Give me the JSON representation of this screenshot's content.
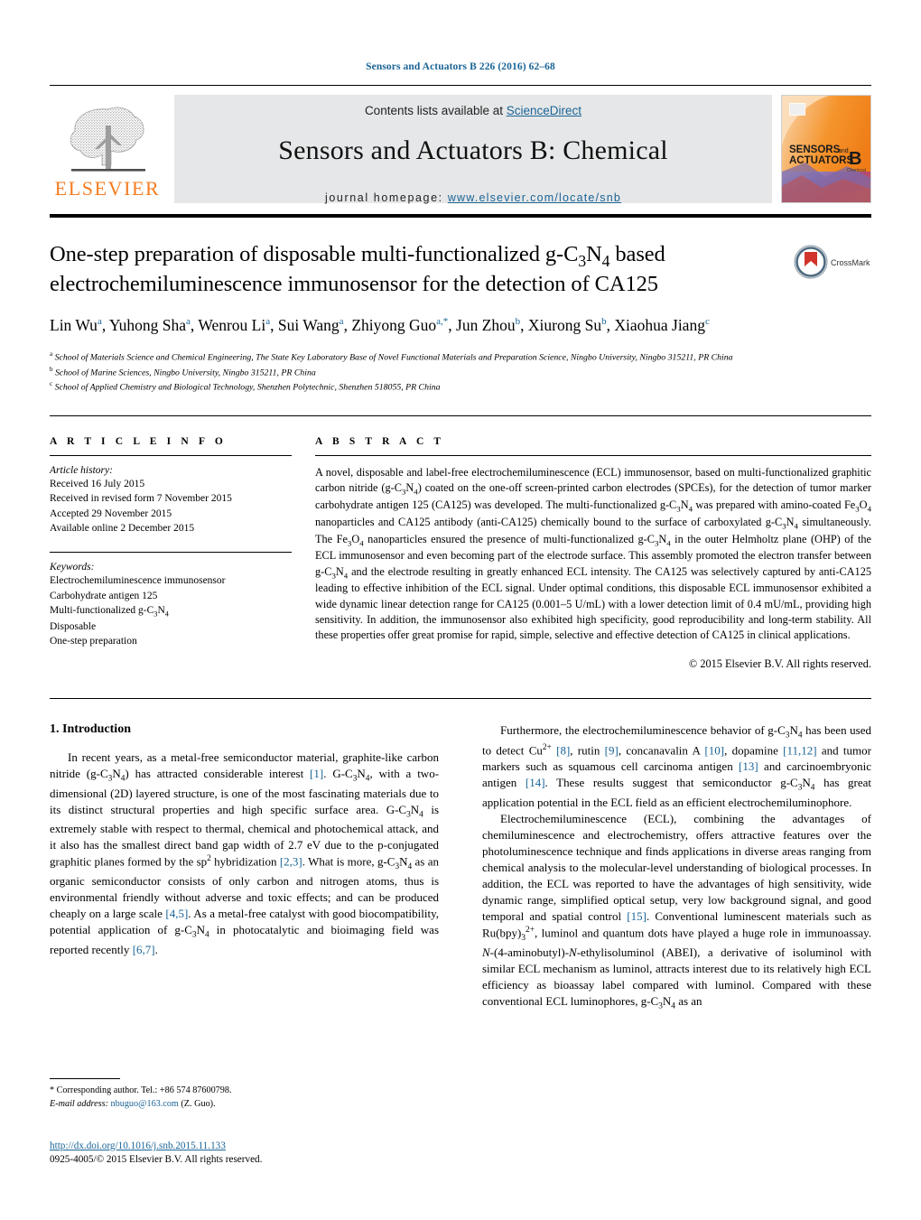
{
  "running_head": "Sensors and Actuators B 226 (2016) 62–68",
  "masthead": {
    "contents_prefix": "Contents lists available at ",
    "sciencedirect": "ScienceDirect",
    "journal_name": "Sensors and Actuators B: Chemical",
    "homepage_label": "journal homepage:",
    "homepage_url": "www.elsevier.com/locate/snb",
    "publisher_logo_text": "ELSEVIER",
    "cover_line1": "SENSORS",
    "cover_and": "and",
    "cover_line2": "ACTUATORS",
    "cover_letter": "B",
    "cover_sub": "Chemical",
    "crossmark_label": "CrossMark",
    "accent_orange": "#f57c20",
    "accent_blue": "#1a6496",
    "band_gray": "#e6e7e8"
  },
  "article": {
    "title_html": "One-step preparation of disposable multi-functionalized g-C<sub>3</sub>N<sub>4</sub> based electrochemiluminescence immunosensor for the detection of CA125",
    "authors_html": "Lin Wu<sup>a</sup>, Yuhong Sha<sup>a</sup>, Wenrou Li<sup>a</sup>, Sui Wang<sup>a</sup>, Zhiyong Guo<sup>a,*</sup>, Jun Zhou<sup>b</sup>, Xiurong Su<sup>b</sup>, Xiaohua Jiang<sup>c</sup>",
    "affiliations_html": "<sup>a</sup> School of Materials Science and Chemical Engineering, The State Key Laboratory Base of Novel Functional Materials and Preparation Science, Ningbo University, Ningbo 315211, PR China<br><sup>b</sup> School of Marine Sciences, Ningbo University, Ningbo 315211, PR China<br><sup>c</sup> School of Applied Chemistry and Biological Technology, Shenzhen Polytechnic, Shenzhen 518055, PR China"
  },
  "article_info": {
    "heading": "A R T I C L E   I N F O",
    "history_title": "Article history:",
    "history": [
      "Received 16 July 2015",
      "Received in revised form 7 November 2015",
      "Accepted 29 November 2015",
      "Available online 2 December 2015"
    ],
    "keywords_title": "Keywords:",
    "keywords_html": [
      "Electrochemiluminescence immunosensor",
      "Carbohydrate antigen 125",
      "Multi-functionalized g-C<sub>3</sub>N<sub>4</sub>",
      "Disposable",
      "One-step preparation"
    ]
  },
  "abstract": {
    "heading": "A B S T R A C T",
    "text_html": "A novel, disposable and label-free electrochemiluminescence (ECL) immunosensor, based on multi-functionalized graphitic carbon nitride (g-C<sub>3</sub>N<sub>4</sub>) coated on the one-off screen-printed carbon electrodes (SPCEs), for the detection of tumor marker carbohydrate antigen 125 (CA125) was developed. The multi-functionalized g-C<sub>3</sub>N<sub>4</sub> was prepared with amino-coated Fe<sub>3</sub>O<sub>4</sub> nanoparticles and CA125 antibody (anti-CA125) chemically bound to the surface of carboxylated g-C<sub>3</sub>N<sub>4</sub> simultaneously. The Fe<sub>3</sub>O<sub>4</sub> nanoparticles ensured the presence of multi-functionalized g-C<sub>3</sub>N<sub>4</sub> in the outer Helmholtz plane (OHP) of the ECL immunosensor and even becoming part of the electrode surface. This assembly promoted the electron transfer between g-C<sub>3</sub>N<sub>4</sub> and the electrode resulting in greatly enhanced ECL intensity. The CA125 was selectively captured by anti-CA125 leading to effective inhibition of the ECL signal. Under optimal conditions, this disposable ECL immunosensor exhibited a wide dynamic linear detection range for CA125 (0.001–5 U/mL) with a lower detection limit of 0.4 mU/mL, providing high sensitivity. In addition, the immunosensor also exhibited high specificity, good reproducibility and long-term stability. All these properties offer great promise for rapid, simple, selective and effective detection of CA125 in clinical applications.",
    "copyright": "© 2015 Elsevier B.V. All rights reserved."
  },
  "body": {
    "section_number_title": "1.  Introduction",
    "left_paragraphs_html": [
      "In recent years, as a metal-free semiconductor material, graphite-like carbon nitride (g-C<sub>3</sub>N<sub>4</sub>) has attracted considerable interest <span class=\"ref\">[1]</span>. G-C<sub>3</sub>N<sub>4</sub>, with a two-dimensional (2D) layered structure, is one of the most fascinating materials due to its distinct structural properties and high specific surface area. G-C<sub>3</sub>N<sub>4</sub> is extremely stable with respect to thermal, chemical and photochemical attack, and it also has the smallest direct band gap width of 2.7 eV due to the p-conjugated graphitic planes formed by the sp<sup>2</sup> hybridization <span class=\"ref\">[2,3]</span>. What is more, g-C<sub>3</sub>N<sub>4</sub> as an organic semiconductor consists of only carbon and nitrogen atoms, thus is environmental friendly without adverse and toxic effects; and can be produced cheaply on a large scale <span class=\"ref\">[4,5]</span>. As a metal-free catalyst with good biocompatibility, potential application of g-C<sub>3</sub>N<sub>4</sub> in photocatalytic and bioimaging field was reported recently <span class=\"ref\">[6,7]</span>."
    ],
    "right_paragraphs_html": [
      "Furthermore, the electrochemiluminescence behavior of g-C<sub>3</sub>N<sub>4</sub> has been used to detect Cu<sup>2+</sup> <span class=\"ref\">[8]</span>, rutin <span class=\"ref\">[9]</span>, concanavalin A <span class=\"ref\">[10]</span>, dopamine <span class=\"ref\">[11,12]</span> and tumor markers such as squamous cell carcinoma antigen <span class=\"ref\">[13]</span> and carcinoembryonic antigen <span class=\"ref\">[14]</span>. These results suggest that semiconductor g-C<sub>3</sub>N<sub>4</sub> has great application potential in the ECL field as an efficient electrochemiluminophore.",
      "Electrochemiluminescence (ECL), combining the advantages of chemiluminescence and electrochemistry, offers attractive features over the photoluminescence technique and finds applications in diverse areas ranging from chemical analysis to the molecular-level understanding of biological processes. In addition, the ECL was reported to have the advantages of high sensitivity, wide dynamic range, simplified optical setup, very low background signal, and good temporal and spatial control <span class=\"ref\">[15]</span>. Conventional luminescent materials such as Ru(bpy)<sub>3</sub><sup>2+</sup>, luminol and quantum dots have played a huge role in immunoassay. <i>N</i>-(4-aminobutyl)-<i>N</i>-ethylisoluminol (ABEI), a derivative of isoluminol with similar ECL mechanism as luminol, attracts interest due to its relatively high ECL efficiency as bioassay label compared with luminol. Compared with these conventional ECL luminophores, g-C<sub>3</sub>N<sub>4</sub> as an"
    ]
  },
  "footnote": {
    "corresponding_html": "<span>*</span> Corresponding author. Tel.: +86 574 87600798.",
    "email_label": "E-mail address:",
    "email": "nbuguo@163.com",
    "email_owner": "(Z. Guo)."
  },
  "colophon": {
    "doi": "http://dx.doi.org/10.1016/j.snb.2015.11.133",
    "issn": "0925-4005/© 2015 Elsevier B.V. All rights reserved."
  }
}
